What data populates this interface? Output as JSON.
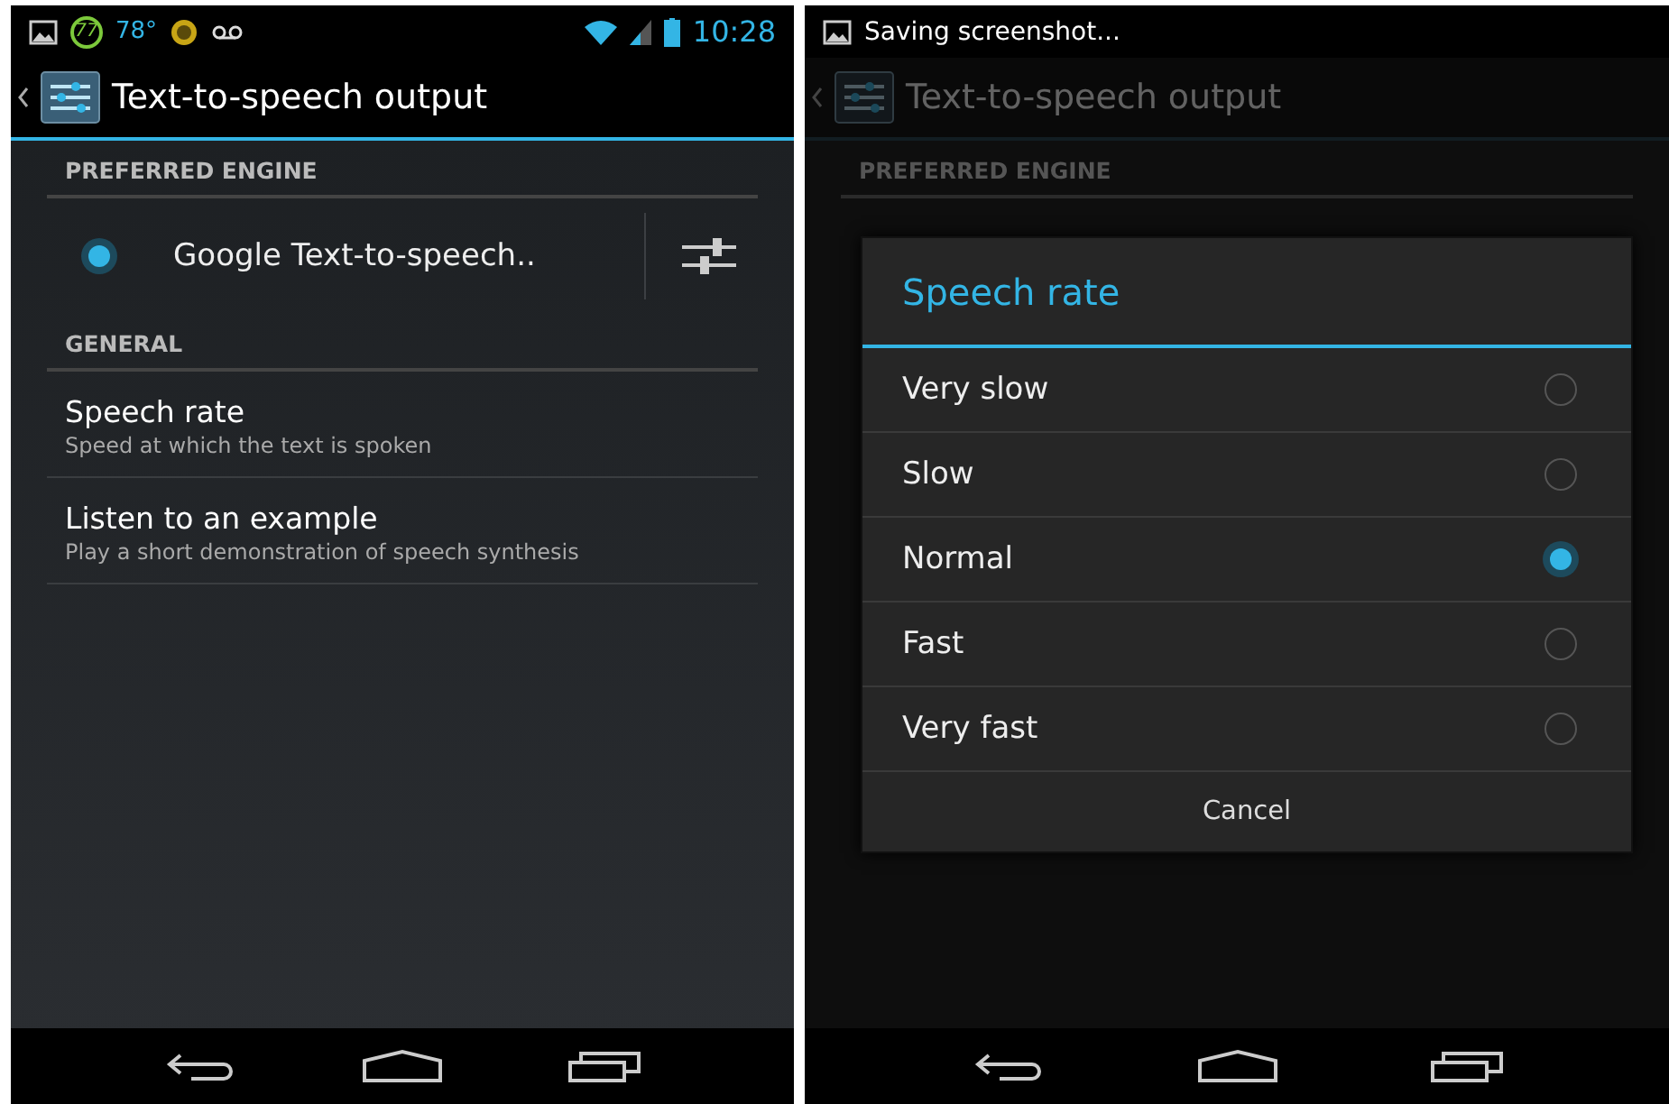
{
  "screens": [
    {
      "status_bar": {
        "badge": "77",
        "temperature": "78°",
        "time": "10:28"
      },
      "action_bar": {
        "title": "Text-to-speech output"
      },
      "sections": [
        {
          "header": "PREFERRED ENGINE",
          "items": [
            {
              "kind": "engine",
              "title": "Google Text-to-speech..",
              "selected": true
            }
          ]
        },
        {
          "header": "GENERAL",
          "items": [
            {
              "kind": "pref",
              "title": "Speech rate",
              "summary": "Speed at which the text is spoken"
            },
            {
              "kind": "pref",
              "title": "Listen to an example",
              "summary": "Play a short demonstration of speech synthesis"
            }
          ]
        }
      ]
    },
    {
      "notification": "Saving screenshot...",
      "action_bar": {
        "title": "Text-to-speech output"
      },
      "section_header": "PREFERRED ENGINE",
      "dialog": {
        "title": "Speech rate",
        "options": [
          {
            "label": "Very slow",
            "selected": false
          },
          {
            "label": "Slow",
            "selected": false
          },
          {
            "label": "Normal",
            "selected": true
          },
          {
            "label": "Fast",
            "selected": false
          },
          {
            "label": "Very fast",
            "selected": false
          }
        ],
        "cancel": "Cancel"
      }
    }
  ]
}
